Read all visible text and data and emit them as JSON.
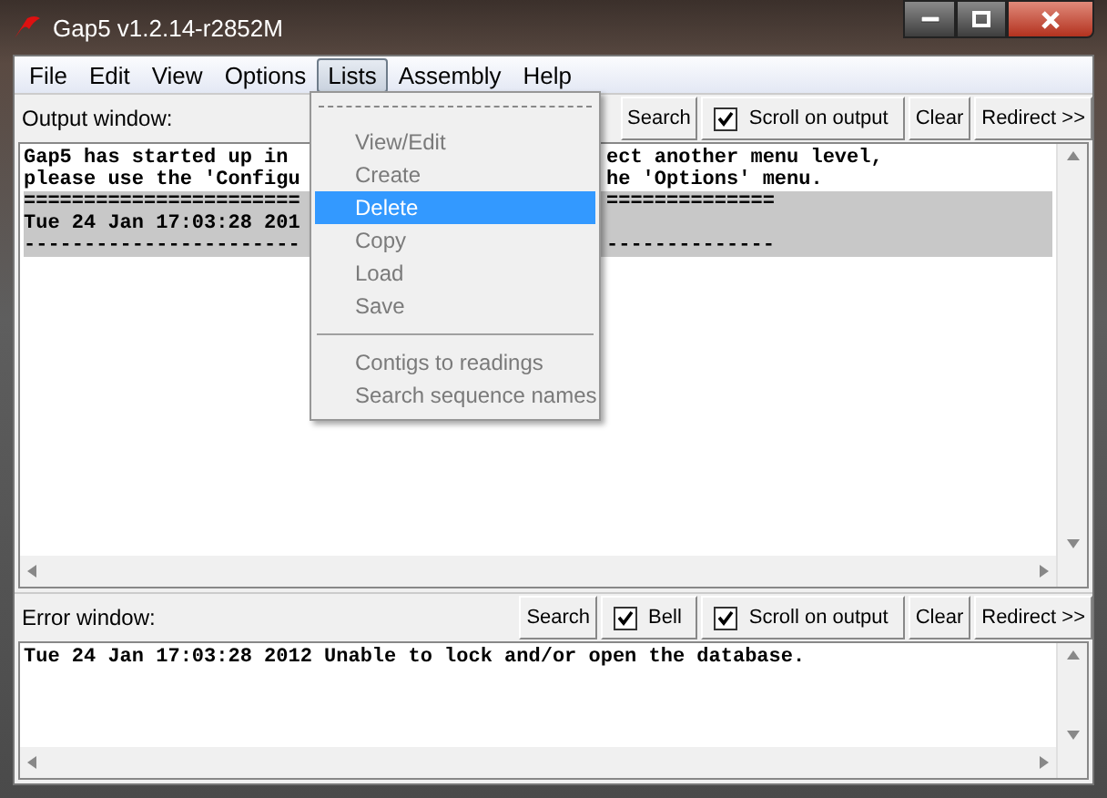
{
  "window": {
    "title": "Gap5 v1.2.14-r2852M"
  },
  "menu_bar": [
    {
      "label": "File",
      "selected": false
    },
    {
      "label": "Edit",
      "selected": false
    },
    {
      "label": "View",
      "selected": false
    },
    {
      "label": "Options",
      "selected": false
    },
    {
      "label": "Lists",
      "selected": true
    },
    {
      "label": "Assembly",
      "selected": false
    },
    {
      "label": "Help",
      "selected": false
    }
  ],
  "lists_menu": {
    "items": [
      {
        "kind": "tearoff"
      },
      {
        "kind": "item",
        "label": "View/Edit",
        "disabled": true,
        "selected": false
      },
      {
        "kind": "item",
        "label": "Create",
        "disabled": true,
        "selected": false
      },
      {
        "kind": "item",
        "label": "Delete",
        "disabled": true,
        "selected": true
      },
      {
        "kind": "item",
        "label": "Copy",
        "disabled": true,
        "selected": false
      },
      {
        "kind": "item",
        "label": "Load",
        "disabled": true,
        "selected": false
      },
      {
        "kind": "item",
        "label": "Save",
        "disabled": true,
        "selected": false
      },
      {
        "kind": "separator"
      },
      {
        "kind": "item",
        "label": "Contigs to readings",
        "disabled": true,
        "selected": false
      },
      {
        "kind": "item",
        "label": "Search sequence names",
        "disabled": true,
        "selected": false
      }
    ]
  },
  "panes": [
    {
      "label": "Output window:",
      "controls": [
        {
          "kind": "button",
          "label": "Search"
        },
        {
          "kind": "checkbox",
          "label": "Scroll on output",
          "checked": true
        },
        {
          "kind": "button",
          "label": "Clear"
        },
        {
          "kind": "button",
          "label": "Redirect >>"
        }
      ],
      "lines": [
        {
          "left": "Gap5 has started up in",
          "right": "ect another menu level,",
          "highlighted": false
        },
        {
          "left": "please use the 'Configu",
          "right": "he 'Options' menu.",
          "highlighted": false
        },
        {
          "left": "=======================",
          "right": "==============",
          "highlighted": true
        },
        {
          "left": "Tue 24 Jan 17:03:28 201",
          "highlighted": true
        },
        {
          "left": "-----------------------",
          "right": "--------------",
          "highlighted": true
        }
      ]
    },
    {
      "label": "Error window:",
      "controls": [
        {
          "kind": "button",
          "label": "Search"
        },
        {
          "kind": "checkbox",
          "label": "Bell",
          "checked": true
        },
        {
          "kind": "checkbox",
          "label": "Scroll on output",
          "checked": true
        },
        {
          "kind": "button",
          "label": "Clear"
        },
        {
          "kind": "button",
          "label": "Redirect >>"
        }
      ],
      "lines": [
        {
          "left": "Tue 24 Jan 17:03:28 2012 Unable to lock and/or open the database.",
          "highlighted": false
        }
      ]
    }
  ]
}
